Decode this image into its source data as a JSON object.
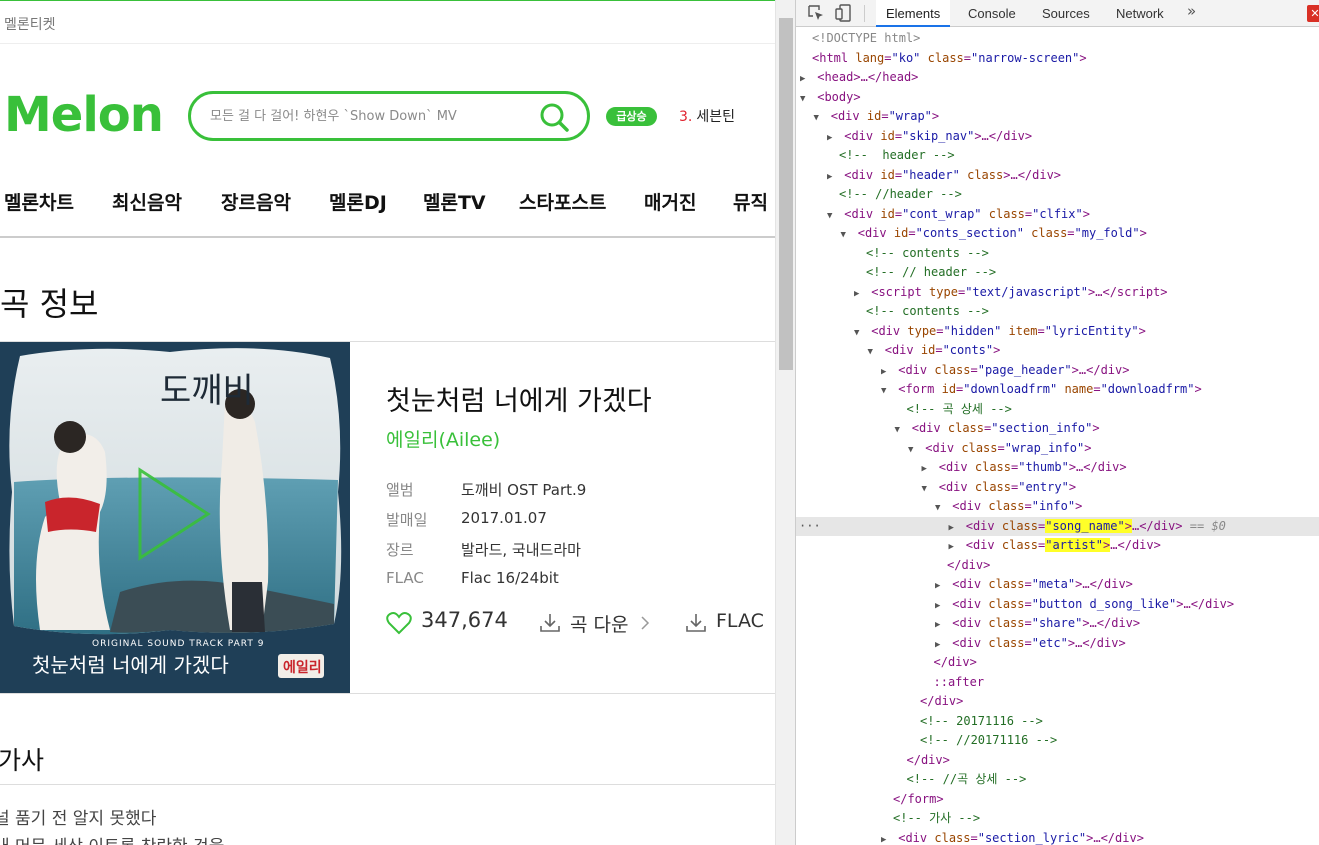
{
  "melon": {
    "ticket_link": "멜론티켓",
    "logo": "Melon",
    "search_placeholder": "모든 걸 다 걸어! 하현우 `Show Down` MV",
    "rank_badge": "급상승",
    "rank_num": "3.",
    "rank_name": "세븐틴",
    "gnb": [
      "멜론차트",
      "최신음악",
      "장르음악",
      "멜론DJ",
      "멜론TV",
      "스타포스트",
      "매거진",
      "뮤직"
    ],
    "page_title": "곡 정보",
    "song_name": "첫눈처럼 너에게 가겠다",
    "artist": "에일리(Ailee)",
    "meta": [
      {
        "label": "앨범",
        "value": "도깨비 OST Part.9"
      },
      {
        "label": "발매일",
        "value": "2017.01.07"
      },
      {
        "label": "장르",
        "value": "발라드, 국내드라마"
      },
      {
        "label": "FLAC",
        "value": "Flac 16/24bit"
      }
    ],
    "like_count": "347,674",
    "download_label": "곡 다운",
    "flac_label": "FLAC",
    "lyric_title": "가사",
    "lyric_lines": [
      "널 품기 전 알지 못했다",
      "내 머문 세상 이토록 찬란한 것을"
    ],
    "cover": {
      "title": "도깨비",
      "footer_en": "ORIGINAL SOUND TRACK PART 9",
      "footer_kr": "첫눈처럼 너에게 가겠다",
      "footer_tag": "에일리"
    }
  },
  "devtools": {
    "tabs": [
      "Elements",
      "Console",
      "Sources",
      "Network"
    ],
    "active_tab": "Elements",
    "more": "»",
    "error_mark": "✕",
    "selected_marker": "== $0",
    "lines": [
      {
        "indent": 0,
        "arrow": "",
        "html": "<span class='dt'>&lt;!DOCTYPE html&gt;</span>"
      },
      {
        "indent": 0,
        "arrow": "",
        "html": "<span class='tag'>&lt;html</span> <span class='an'>lang</span>=<span class='av'>\"ko\"</span> <span class='an'>class</span>=<span class='av'>\"narrow-screen\"</span><span class='tag'>&gt;</span>"
      },
      {
        "indent": 0,
        "arrow": "▶",
        "html": "<span class='tag'>&lt;head&gt;</span>…<span class='tag'>&lt;/head&gt;</span>"
      },
      {
        "indent": 0,
        "arrow": "▼",
        "html": "<span class='tag'>&lt;body&gt;</span>"
      },
      {
        "indent": 1,
        "arrow": "▼",
        "html": "<span class='tag'>&lt;div</span> <span class='an'>id</span>=<span class='av'>\"wrap\"</span><span class='tag'>&gt;</span>"
      },
      {
        "indent": 2,
        "arrow": "▶",
        "html": "<span class='tag'>&lt;div</span> <span class='an'>id</span>=<span class='av'>\"skip_nav\"</span><span class='tag'>&gt;</span>…<span class='tag'>&lt;/div&gt;</span>"
      },
      {
        "indent": 2,
        "arrow": "",
        "html": "<span class='cm'>&lt;!--  header --&gt;</span>"
      },
      {
        "indent": 2,
        "arrow": "▶",
        "html": "<span class='tag'>&lt;div</span> <span class='an'>id</span>=<span class='av'>\"header\"</span> <span class='an'>class</span><span class='tag'>&gt;</span>…<span class='tag'>&lt;/div&gt;</span>"
      },
      {
        "indent": 2,
        "arrow": "",
        "html": "<span class='cm'>&lt;!-- //header --&gt;</span>"
      },
      {
        "indent": 2,
        "arrow": "▼",
        "html": "<span class='tag'>&lt;div</span> <span class='an'>id</span>=<span class='av'>\"cont_wrap\"</span> <span class='an'>class</span>=<span class='av'>\"clfix\"</span><span class='tag'>&gt;</span>"
      },
      {
        "indent": 3,
        "arrow": "▼",
        "html": "<span class='tag'>&lt;div</span> <span class='an'>id</span>=<span class='av'>\"conts_section\"</span> <span class='an'>class</span>=<span class='av'>\"my_fold\"</span><span class='tag'>&gt;</span>"
      },
      {
        "indent": 4,
        "arrow": "",
        "html": "<span class='cm'>&lt;!-- contents --&gt;</span>"
      },
      {
        "indent": 4,
        "arrow": "",
        "html": "<span class='cm'>&lt;!-- // header --&gt;</span>"
      },
      {
        "indent": 4,
        "arrow": "▶",
        "html": "<span class='tag'>&lt;script</span> <span class='an'>type</span>=<span class='av'>\"text/javascript\"</span><span class='tag'>&gt;</span>…<span class='tag'>&lt;/script&gt;</span>"
      },
      {
        "indent": 4,
        "arrow": "",
        "html": "<span class='cm'>&lt;!-- contents --&gt;</span>"
      },
      {
        "indent": 4,
        "arrow": "▼",
        "html": "<span class='tag'>&lt;div</span> <span class='an'>type</span>=<span class='av'>\"hidden\"</span> <span class='an'>item</span>=<span class='av'>\"lyricEntity\"</span><span class='tag'>&gt;</span>"
      },
      {
        "indent": 5,
        "arrow": "▼",
        "html": "<span class='tag'>&lt;div</span> <span class='an'>id</span>=<span class='av'>\"conts\"</span><span class='tag'>&gt;</span>"
      },
      {
        "indent": 6,
        "arrow": "▶",
        "html": "<span class='tag'>&lt;div</span> <span class='an'>class</span>=<span class='av'>\"page_header\"</span><span class='tag'>&gt;</span>…<span class='tag'>&lt;/div&gt;</span>"
      },
      {
        "indent": 6,
        "arrow": "▼",
        "html": "<span class='tag'>&lt;form</span> <span class='an'>id</span>=<span class='av'>\"downloadfrm\"</span> <span class='an'>name</span>=<span class='av'>\"downloadfrm\"</span><span class='tag'>&gt;</span>"
      },
      {
        "indent": 7,
        "arrow": "",
        "html": "<span class='cm'>&lt;!-- 곡 상세 --&gt;</span>"
      },
      {
        "indent": 7,
        "arrow": "▼",
        "html": "<span class='tag'>&lt;div</span> <span class='an'>class</span>=<span class='av'>\"section_info\"</span><span class='tag'>&gt;</span>"
      },
      {
        "indent": 8,
        "arrow": "▼",
        "html": "<span class='tag'>&lt;div</span> <span class='an'>class</span>=<span class='av'>\"wrap_info\"</span><span class='tag'>&gt;</span>"
      },
      {
        "indent": 9,
        "arrow": "▶",
        "html": "<span class='tag'>&lt;div</span> <span class='an'>class</span>=<span class='av'>\"thumb\"</span><span class='tag'>&gt;</span>…<span class='tag'>&lt;/div&gt;</span>"
      },
      {
        "indent": 9,
        "arrow": "▼",
        "html": "<span class='tag'>&lt;div</span> <span class='an'>class</span>=<span class='av'>\"entry\"</span><span class='tag'>&gt;</span>"
      },
      {
        "indent": 10,
        "arrow": "▼",
        "html": "<span class='tag'>&lt;div</span> <span class='an'>class</span>=<span class='av'>\"info\"</span><span class='tag'>&gt;</span>"
      },
      {
        "indent": 11,
        "arrow": "▶",
        "selected": true,
        "html": "<span class='tag'>&lt;div</span> <span class='an'>class</span>=<span class='hl'><span class='av'>\"song_name\"</span><span class='tag'>&gt;</span></span>…<span class='tag'>&lt;/div&gt;</span> <span class='eq'>== $0</span>"
      },
      {
        "indent": 11,
        "arrow": "▶",
        "html": "<span class='tag'>&lt;div</span> <span class='an'>class</span>=<span class='hl'><span class='av'>\"artist\"</span><span class='tag'>&gt;</span></span>…<span class='tag'>&lt;/div&gt;</span>"
      },
      {
        "indent": 10,
        "arrow": "",
        "html": "<span class='tag'>&lt;/div&gt;</span>"
      },
      {
        "indent": 10,
        "arrow": "▶",
        "html": "<span class='tag'>&lt;div</span> <span class='an'>class</span>=<span class='av'>\"meta\"</span><span class='tag'>&gt;</span>…<span class='tag'>&lt;/div&gt;</span>"
      },
      {
        "indent": 10,
        "arrow": "▶",
        "html": "<span class='tag'>&lt;div</span> <span class='an'>class</span>=<span class='av'>\"button d_song_like\"</span><span class='tag'>&gt;</span>…<span class='tag'>&lt;/div&gt;</span>"
      },
      {
        "indent": 10,
        "arrow": "▶",
        "html": "<span class='tag'>&lt;div</span> <span class='an'>class</span>=<span class='av'>\"share\"</span><span class='tag'>&gt;</span>…<span class='tag'>&lt;/div&gt;</span>"
      },
      {
        "indent": 10,
        "arrow": "▶",
        "html": "<span class='tag'>&lt;div</span> <span class='an'>class</span>=<span class='av'>\"etc\"</span><span class='tag'>&gt;</span>…<span class='tag'>&lt;/div&gt;</span>"
      },
      {
        "indent": 9,
        "arrow": "",
        "html": "<span class='tag'>&lt;/div&gt;</span>"
      },
      {
        "indent": 9,
        "arrow": "",
        "html": "<span class='ps'>::after</span>"
      },
      {
        "indent": 8,
        "arrow": "",
        "html": "<span class='tag'>&lt;/div&gt;</span>"
      },
      {
        "indent": 8,
        "arrow": "",
        "html": "<span class='cm'>&lt;!-- 20171116 --&gt;</span>"
      },
      {
        "indent": 8,
        "arrow": "",
        "html": "<span class='cm'>&lt;!-- //20171116 --&gt;</span>"
      },
      {
        "indent": 7,
        "arrow": "",
        "html": "<span class='tag'>&lt;/div&gt;</span>"
      },
      {
        "indent": 7,
        "arrow": "",
        "html": "<span class='cm'>&lt;!-- //곡 상세 --&gt;</span>"
      },
      {
        "indent": 6,
        "arrow": "",
        "html": "<span class='tag'>&lt;/form&gt;</span>"
      },
      {
        "indent": 6,
        "arrow": "",
        "html": "<span class='cm'>&lt;!-- 가사 --&gt;</span>"
      },
      {
        "indent": 6,
        "arrow": "▶",
        "html": "<span class='tag'>&lt;div</span> <span class='an'>class</span>=<span class='av'>\"section_lyric\"</span><span class='tag'>&gt;</span>…<span class='tag'>&lt;/div&gt;</span>"
      }
    ]
  }
}
